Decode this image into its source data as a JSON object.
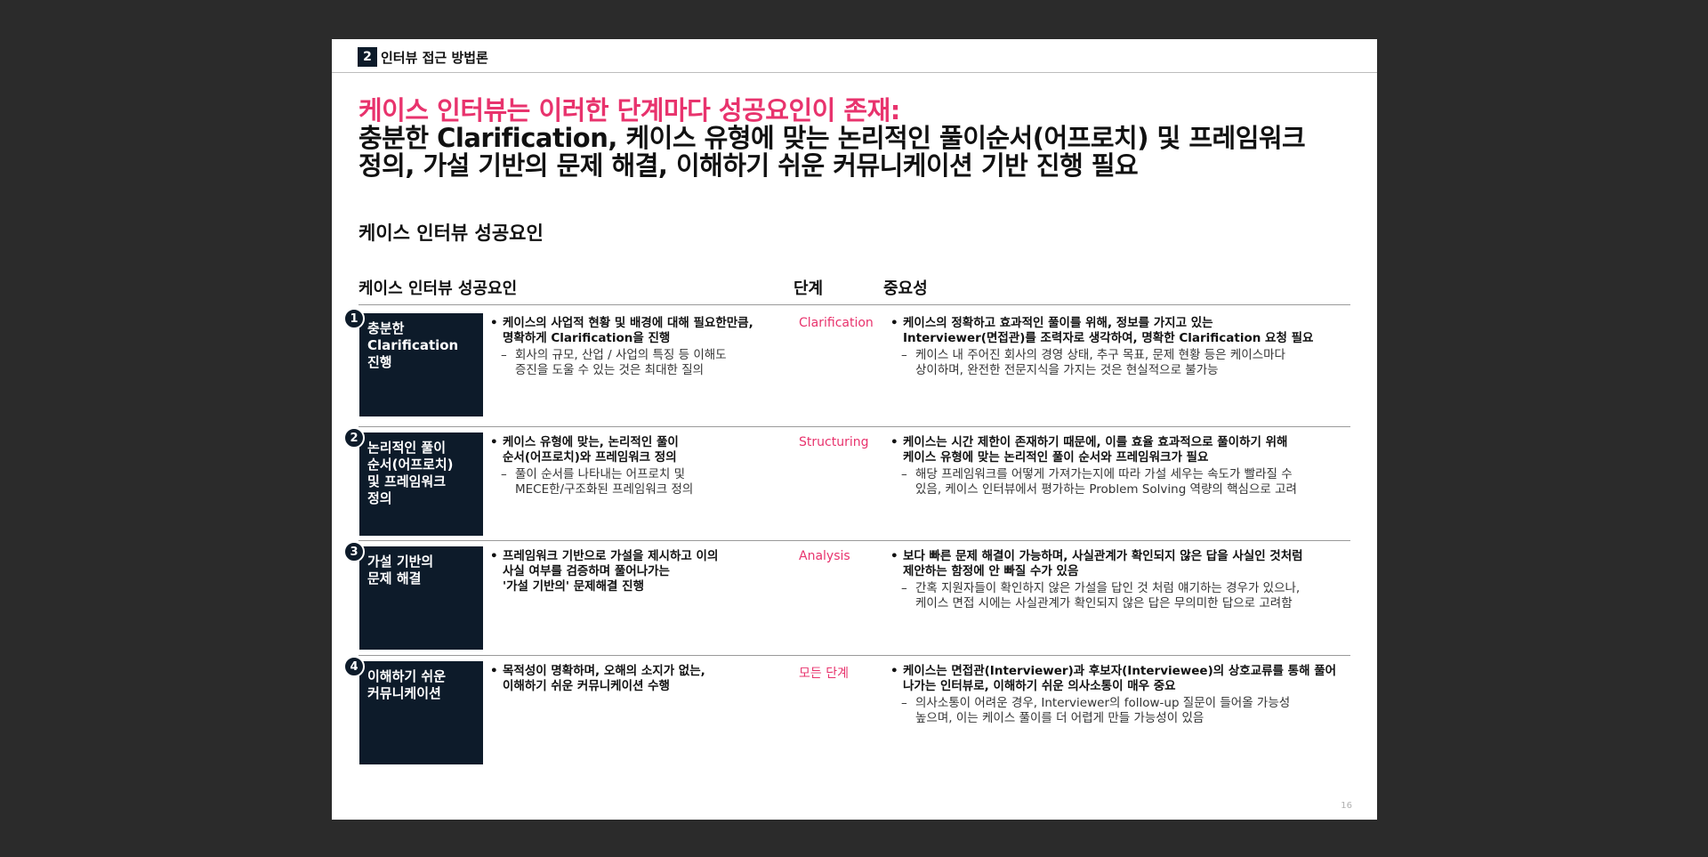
{
  "section": {
    "number": "2",
    "title": "인터뷰 접근 방법론"
  },
  "headline": {
    "line1": "케이스 인터뷰는 이러한 단계마다 성공요인이 존재:",
    "line2": "충분한 Clarification, 케이스 유형에 맞는 논리적인 풀이순서(어프로치) 및 프레임워크",
    "line3": "정의, 가설 기반의 문제 해결, 이해하기 쉬운 커뮤니케이션 기반 진행 필요"
  },
  "subtitle": "케이스 인터뷰 성공요인",
  "columns": {
    "factor": "케이스 인터뷰 성공요인",
    "stage": "단계",
    "importance": "중요성"
  },
  "rows": [
    {
      "num": "1",
      "title": "충분한\nClarification\n진행",
      "desc_main": "케이스의 사업적 현황 및 배경에 대해 필요한만큼,\n명확하게 Clarification을 진행",
      "desc_sub": "회사의 규모, 산업 / 사업의 특징 등 이해도\n증진을 도울 수 있는 것은 최대한 질의",
      "stage": "Clarification",
      "imp_main": "케이스의 정확하고 효과적인 풀이를 위해, 정보를 가지고 있는\nInterviewer(면접관)를 조력자로 생각하여, 명확한 Clarification 요청 필요",
      "imp_sub": "케이스 내 주어진 회사의 경영 상태, 추구 목표, 문제 현황 등은 케이스마다\n상이하며, 완전한 전문지식을 가지는 것은 현실적으로 불가능"
    },
    {
      "num": "2",
      "title": "논리적인 풀이\n순서(어프로치)\n및 프레임워크\n정의",
      "desc_main": "케이스 유형에 맞는, 논리적인 풀이\n순서(어프로치)와 프레임워크 정의",
      "desc_sub": "풀이 순서를 나타내는 어프로치 및\nMECE한/구조화된 프레임워크 정의",
      "stage": "Structuring",
      "imp_main": "케이스는 시간 제한이 존재하기 때문에, 이를 효율 효과적으로 풀이하기 위해\n케이스 유형에 맞는 논리적인 풀이 순서와 프레임워크가 필요",
      "imp_sub": "해당 프레임워크를 어떻게 가져가는지에 따라 가설 세우는 속도가 빨라질 수\n있음, 케이스 인터뷰에서 평가하는 Problem Solving 역량의 핵심으로 고려"
    },
    {
      "num": "3",
      "title": "가설 기반의\n문제 해결",
      "desc_main": "프레임워크 기반으로 가설을 제시하고 이의\n사실 여부를 검증하며 풀어나가는\n'가설 기반의' 문제해결 진행",
      "desc_sub": "",
      "stage": "Analysis",
      "imp_main": "보다 빠른 문제 해결이 가능하며, 사실관계가 확인되지 않은 답을 사실인 것처럼\n제안하는 함정에 안 빠질 수가 있음",
      "imp_sub": "간혹 지원자들이 확인하지 않은 가설을 답인 것 처럼 얘기하는 경우가 있으나,\n케이스 면접 시에는 사실관계가 확인되지 않은 답은 무의미한 답으로 고려함"
    },
    {
      "num": "4",
      "title": "이해하기 쉬운\n커뮤니케이션",
      "desc_main": "목적성이 명확하며, 오해의 소지가 없는,\n이해하기 쉬운 커뮤니케이션 수행",
      "desc_sub": "",
      "stage": "모든 단계",
      "imp_main": "케이스는 면접관(Interviewer)과 후보자(Interviewee)의 상호교류를 통해 풀어\n나가는 인터뷰로, 이해하기 쉬운 의사소통이 매우 중요",
      "imp_sub": "의사소통이 어려운 경우, Interviewer의 follow-up 질문이 들어올 가능성\n높으며, 이는 케이스 풀이를 더 어렵게 만들 가능성이 있음"
    }
  ],
  "page_number": "16",
  "colors": {
    "accent": "#e8336d",
    "navy": "#0d1b2a"
  }
}
